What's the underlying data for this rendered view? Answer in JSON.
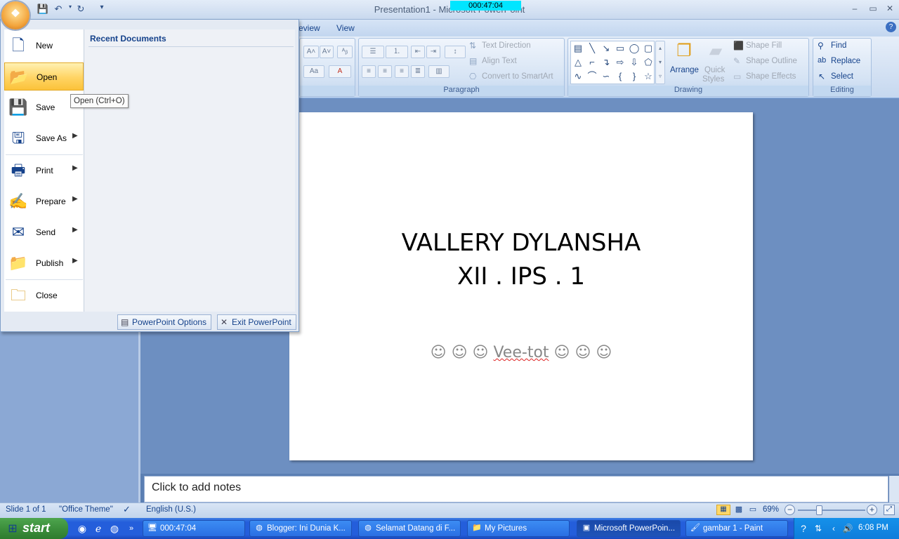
{
  "window": {
    "title": "Presentation1 - Microsoft PowerPoint",
    "timer_overlay": "000:47:04",
    "minimize_icon": "minimize-icon",
    "restore_icon": "restore-icon",
    "close_icon": "close-icon"
  },
  "ribbon": {
    "tabs": [
      "eview",
      "View"
    ],
    "font_group": {
      "label": ""
    },
    "paragraph_group": {
      "label": "Paragraph",
      "text_direction": "Text Direction",
      "align_text": "Align Text",
      "convert_smartart": "Convert to SmartArt"
    },
    "drawing_group": {
      "label": "Drawing",
      "arrange": "Arrange",
      "quick_styles_line1": "Quick",
      "quick_styles_line2": "Styles",
      "shape_fill": "Shape Fill",
      "shape_outline": "Shape Outline",
      "shape_effects": "Shape Effects"
    },
    "editing_group": {
      "label": "Editing",
      "find": "Find",
      "replace": "Replace",
      "select": "Select"
    }
  },
  "office_menu": {
    "items": [
      {
        "label": "New",
        "icon": "new-document-icon"
      },
      {
        "label": "Open",
        "icon": "open-folder-icon",
        "active": true
      },
      {
        "label": "Save",
        "icon": "save-disk-icon"
      },
      {
        "label": "Save As",
        "icon": "save-as-icon",
        "submenu": true
      },
      {
        "label": "Print",
        "icon": "printer-icon",
        "submenu": true
      },
      {
        "label": "Prepare",
        "icon": "prepare-icon",
        "submenu": true
      },
      {
        "label": "Send",
        "icon": "send-icon",
        "submenu": true
      },
      {
        "label": "Publish",
        "icon": "publish-icon",
        "submenu": true
      },
      {
        "label": "Close",
        "icon": "close-folder-icon"
      }
    ],
    "recent_title": "Recent Documents",
    "tooltip": "Open (Ctrl+O)",
    "options_button": "PowerPoint Options",
    "exit_button": "Exit PowerPoint"
  },
  "slide": {
    "title_line1": "VALLERY DYLANSHA",
    "title_line2": "XII . IPS . 1",
    "subtitle_left": "☺ ☺ ☺ ",
    "subtitle_word": "Vee-tot",
    "subtitle_right": " ☺ ☺ ☺"
  },
  "notes": {
    "placeholder": "Click to add notes"
  },
  "statusbar": {
    "slide": "Slide 1 of 1",
    "theme": "\"Office Theme\"",
    "language": "English (U.S.)",
    "zoom": "69%"
  },
  "taskbar": {
    "start": "start",
    "tasks": [
      {
        "label": "000:47:04",
        "icon": "monitor-icon"
      },
      {
        "label": "Blogger: Ini Dunia K...",
        "icon": "firefox-icon"
      },
      {
        "label": "Selamat Datang di F...",
        "icon": "firefox-icon"
      },
      {
        "label": "My Pictures",
        "icon": "folder-icon"
      },
      {
        "label": "Microsoft PowerPoin...",
        "icon": "powerpoint-icon",
        "active": true
      },
      {
        "label": "gambar 1 - Paint",
        "icon": "paint-icon"
      }
    ],
    "clock": "6:08 PM"
  },
  "colors": {
    "accent_orange": "#fbc23a",
    "ribbon_blue": "#15428b",
    "taskbar_blue": "#245edb",
    "timer_cyan": "#00e5ff"
  }
}
